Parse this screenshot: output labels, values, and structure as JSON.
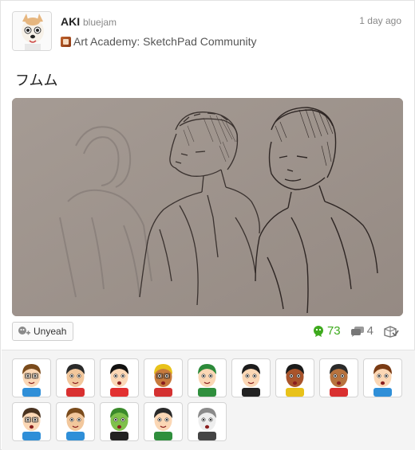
{
  "author": {
    "name": "AKI",
    "id": "bluejam",
    "timestamp": "1 day ago",
    "avatar_icon": "dog-mii-avatar-icon"
  },
  "community": {
    "name": "Art Academy: SketchPad Community",
    "icon": "art-academy-icon"
  },
  "post": {
    "body": "フムム",
    "image_icon": "pencil-sketch-drawing"
  },
  "actions": {
    "yeah_label": "Unyeah",
    "yeah_count": "73",
    "comment_count": "4"
  },
  "colors": {
    "yeah_green": "#3eaa1d",
    "sketch_background": "#9e948d",
    "empathy_background": "#f4f4f4"
  },
  "empathies": [
    {
      "skin": "#fbd7b5",
      "hair": "#7a4b1c",
      "shirt": "#2f8fd8",
      "glasses": true,
      "mouth": "smile"
    },
    {
      "skin": "#f2c79c",
      "hair": "#2a2a2a",
      "shirt": "#d93030",
      "glasses": false,
      "mouth": "smile"
    },
    {
      "skin": "#fbd7b5",
      "hair": "#111111",
      "shirt": "#e23030",
      "glasses": false,
      "mouth": "open"
    },
    {
      "skin": "#c77a3c",
      "hair": "#e8c21a",
      "shirt": "#d43131",
      "glasses": true,
      "mouth": "open"
    },
    {
      "skin": "#fbd7b5",
      "hair": "#2c8a3a",
      "shirt": "#2f8f3d",
      "glasses": false,
      "mouth": "smile"
    },
    {
      "skin": "#fbd7b5",
      "hair": "#1c1c1c",
      "shirt": "#222222",
      "glasses": false,
      "mouth": "smile"
    },
    {
      "skin": "#a9542b",
      "hair": "#1a1a1a",
      "shirt": "#e8c21a",
      "glasses": false,
      "mouth": "open"
    },
    {
      "skin": "#b8733e",
      "hair": "#2a2a2a",
      "shirt": "#d93030",
      "glasses": false,
      "mouth": "open"
    },
    {
      "skin": "#fbd7b5",
      "hair": "#7a3b14",
      "shirt": "#2f8fd8",
      "glasses": false,
      "mouth": "open"
    },
    {
      "skin": "#fbd7b5",
      "hair": "#4a3320",
      "shirt": "#2f8fd8",
      "glasses": true,
      "mouth": "open"
    },
    {
      "skin": "#f2c79c",
      "hair": "#7a4b1c",
      "shirt": "#2f8fd8",
      "glasses": false,
      "mouth": "smile"
    },
    {
      "skin": "#7fc04b",
      "hair": "#3a8a2a",
      "shirt": "#222222",
      "glasses": false,
      "mouth": "open"
    },
    {
      "skin": "#fbd7b5",
      "hair": "#2a2a2a",
      "shirt": "#2f8f3d",
      "glasses": false,
      "mouth": "smile"
    },
    {
      "skin": "#eeeeee",
      "hair": "#8a8a8a",
      "shirt": "#444444",
      "glasses": false,
      "mouth": "open"
    }
  ]
}
